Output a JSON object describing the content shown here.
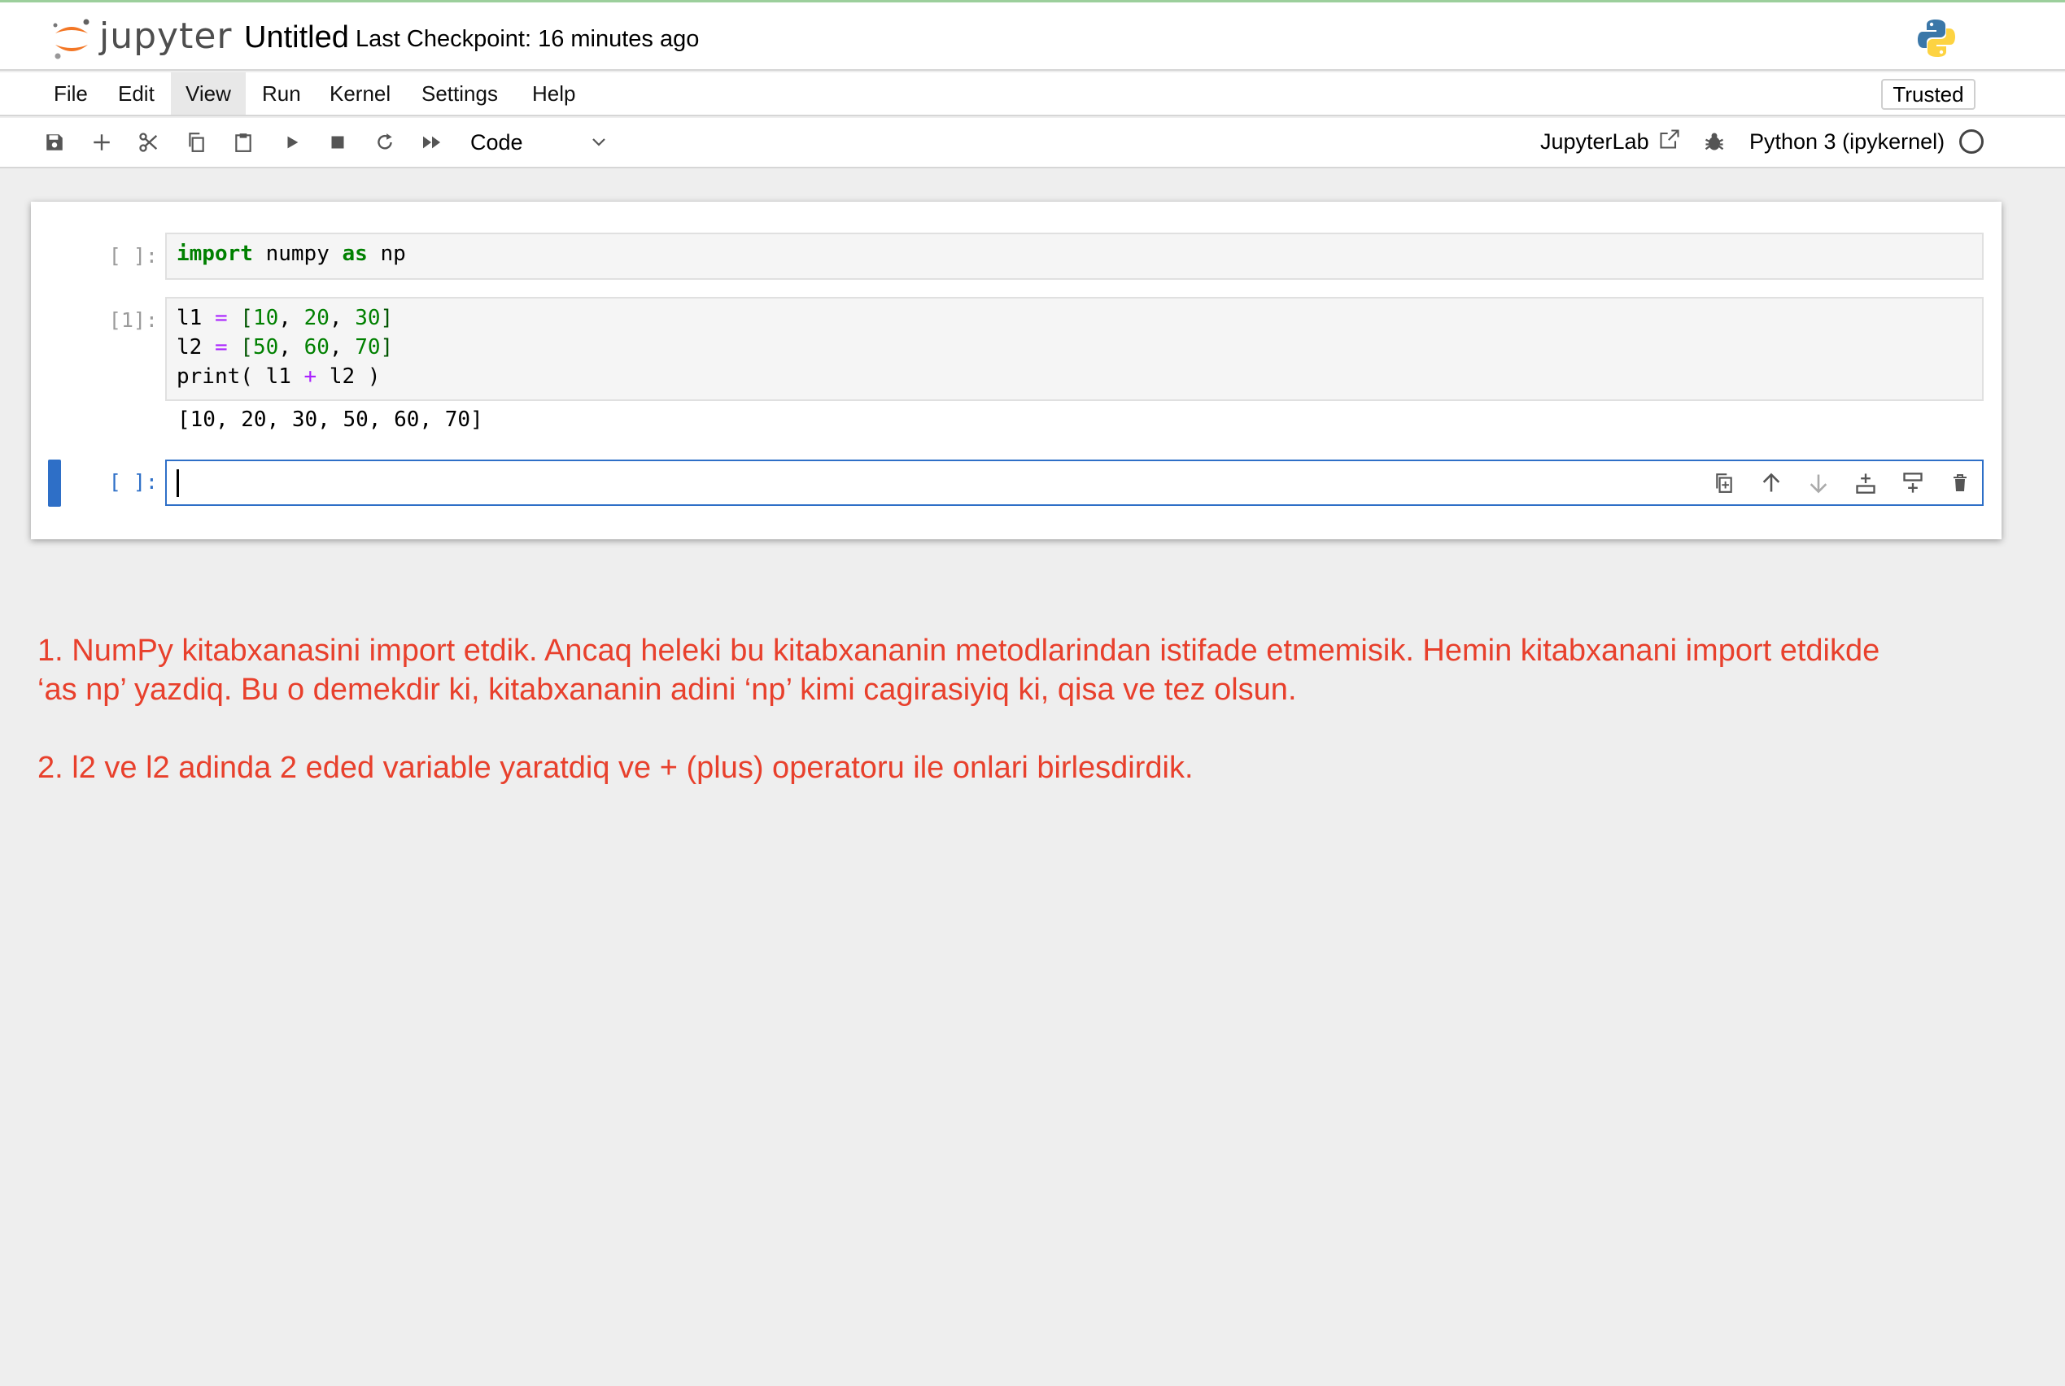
{
  "header": {
    "logo_text": "jupyter",
    "notebook_title": "Untitled",
    "checkpoint": "Last Checkpoint: 16 minutes ago",
    "kernel_logo_icon": "python-logo-icon"
  },
  "menu": {
    "items": [
      {
        "label": "File"
      },
      {
        "label": "Edit"
      },
      {
        "label": "View"
      },
      {
        "label": "Run"
      },
      {
        "label": "Kernel"
      },
      {
        "label": "Settings"
      },
      {
        "label": "Help"
      }
    ],
    "active": "View",
    "trusted_label": "Trusted"
  },
  "toolbar": {
    "icons": [
      "save-icon",
      "add-cell-icon",
      "cut-icon",
      "copy-icon",
      "paste-icon",
      "run-icon",
      "stop-icon",
      "restart-icon",
      "run-all-icon"
    ],
    "cell_type": "Code",
    "jupyterlab_label": "JupyterLab",
    "kernel_name": "Python 3 (ipykernel)"
  },
  "cells": {
    "cell1": {
      "prompt": "[ ]:",
      "tokens": {
        "kw1": "import",
        "t1": " numpy ",
        "kw2": "as",
        "t2": " np"
      }
    },
    "cell2": {
      "prompt": "[1]:",
      "line1": {
        "a": "l1 ",
        "op": "=",
        "b": " ",
        "lb": "[",
        "n1": "10",
        "c1": ", ",
        "n2": "20",
        "c2": ", ",
        "n3": "30",
        "rb": "]"
      },
      "line2": {
        "a": "l2 ",
        "op": "=",
        "b": " ",
        "lb": "[",
        "n1": "50",
        "c1": ", ",
        "n2": "60",
        "c2": ", ",
        "n3": "70",
        "rb": "]"
      },
      "line3": {
        "a": "print( l1 ",
        "op": "+",
        "b": " l2 )"
      },
      "output": "[10, 20, 30, 50, 60, 70]"
    },
    "cell3": {
      "prompt": "[ ]:",
      "tools": [
        "duplicate-cell-icon",
        "move-up-icon",
        "move-down-icon",
        "insert-above-icon",
        "insert-below-icon",
        "delete-cell-icon"
      ]
    }
  },
  "notes": {
    "note1_line1": "1. NumPy kitabxanasini import etdik. Ancaq heleki bu kitabxananin metodlarindan istifade etmemisik. Hemin kitabxanani import etdikde",
    "note1_line2": "‘as np’ yazdiq. Bu o demekdir ki, kitabxananin adini ‘np’ kimi cagirasiyiq ki, qisa ve tez olsun.",
    "note2": "2. l2 ve l2 adinda 2 eded variable yaratdiq ve + (plus) operatoru ile onlari birlesdirdik."
  },
  "colors": {
    "accent": "#2e6fc7",
    "note_text": "#e8402c",
    "keyword": "#008000",
    "operator": "#aa22ff"
  }
}
